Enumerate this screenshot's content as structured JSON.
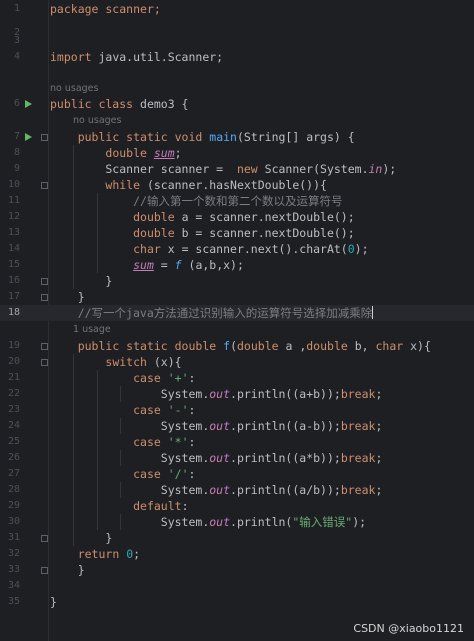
{
  "editor": {
    "hints": {
      "class_usages": "no usages",
      "main_usages": "no usages",
      "f_usages": "1 usage"
    },
    "lines": [
      {
        "n": "1",
        "code": [
          {
            "t": "package scanner;",
            "c": "kw-pkg"
          }
        ]
      },
      {
        "n": "2",
        "code": []
      },
      {
        "n": "3",
        "code": []
      },
      {
        "n": "4",
        "code": [
          {
            "t": "import",
            "c": "kw"
          },
          {
            "t": " java.util.Scanner;"
          }
        ]
      },
      {
        "n": "6",
        "code": [
          {
            "t": "public class",
            "c": "kw"
          },
          {
            "t": " demo3 {"
          }
        ]
      },
      {
        "n": "7",
        "code": [
          {
            "t": "    "
          },
          {
            "t": "public static void",
            "c": "kw"
          },
          {
            "t": " "
          },
          {
            "t": "main",
            "c": "fn"
          },
          {
            "t": "(String[] args) {"
          }
        ]
      },
      {
        "n": "8",
        "code": [
          {
            "t": "        "
          },
          {
            "t": "double",
            "c": "kw"
          },
          {
            "t": " "
          },
          {
            "t": "sum",
            "c": "st ul"
          },
          {
            "t": ";"
          }
        ]
      },
      {
        "n": "9",
        "code": [
          {
            "t": "        Scanner scanner =  "
          },
          {
            "t": "new",
            "c": "kw"
          },
          {
            "t": " Scanner(System."
          },
          {
            "t": "in",
            "c": "st"
          },
          {
            "t": ");"
          }
        ]
      },
      {
        "n": "10",
        "code": [
          {
            "t": "        "
          },
          {
            "t": "while",
            "c": "kw"
          },
          {
            "t": " (scanner.hasNextDouble()){"
          }
        ]
      },
      {
        "n": "11",
        "code": [
          {
            "t": "            "
          },
          {
            "t": "//输入第一个数和第二个数以及运算符号",
            "c": "cm"
          }
        ]
      },
      {
        "n": "12",
        "code": [
          {
            "t": "            "
          },
          {
            "t": "double",
            "c": "kw"
          },
          {
            "t": " a = scanner.nextDouble();"
          }
        ]
      },
      {
        "n": "13",
        "code": [
          {
            "t": "            "
          },
          {
            "t": "double",
            "c": "kw"
          },
          {
            "t": " b = scanner.nextDouble();"
          }
        ]
      },
      {
        "n": "14",
        "code": [
          {
            "t": "            "
          },
          {
            "t": "char",
            "c": "kw"
          },
          {
            "t": " x = scanner.next().charAt("
          },
          {
            "t": "0",
            "c": "num"
          },
          {
            "t": ");"
          }
        ]
      },
      {
        "n": "15",
        "code": [
          {
            "t": "            "
          },
          {
            "t": "sum",
            "c": "st ul"
          },
          {
            "t": " = "
          },
          {
            "t": "f",
            "c": "fn-it"
          },
          {
            "t": " (a,b,x);"
          }
        ]
      },
      {
        "n": "16",
        "code": [
          {
            "t": "        }"
          }
        ]
      },
      {
        "n": "17",
        "code": [
          {
            "t": "    }"
          }
        ]
      },
      {
        "n": "18",
        "code": [
          {
            "t": "    "
          },
          {
            "t": "//写一个java方法通过识别输入的运算符号选择加减乘除",
            "c": "cm"
          }
        ]
      },
      {
        "n": "19",
        "code": [
          {
            "t": "    "
          },
          {
            "t": "public static double",
            "c": "kw"
          },
          {
            "t": " "
          },
          {
            "t": "f",
            "c": "fn"
          },
          {
            "t": "("
          },
          {
            "t": "double",
            "c": "kw"
          },
          {
            "t": " a ,"
          },
          {
            "t": "double",
            "c": "kw"
          },
          {
            "t": " b, "
          },
          {
            "t": "char",
            "c": "kw"
          },
          {
            "t": " x){"
          }
        ]
      },
      {
        "n": "20",
        "code": [
          {
            "t": "        "
          },
          {
            "t": "switch",
            "c": "kw"
          },
          {
            "t": " (x){"
          }
        ]
      },
      {
        "n": "21",
        "code": [
          {
            "t": "            "
          },
          {
            "t": "case",
            "c": "kw"
          },
          {
            "t": " "
          },
          {
            "t": "'+'",
            "c": "str"
          },
          {
            "t": ":"
          }
        ]
      },
      {
        "n": "22",
        "code": [
          {
            "t": "                System."
          },
          {
            "t": "out",
            "c": "st"
          },
          {
            "t": ".println((a+b));"
          },
          {
            "t": "break",
            "c": "kw"
          },
          {
            "t": ";"
          }
        ]
      },
      {
        "n": "23",
        "code": [
          {
            "t": "            "
          },
          {
            "t": "case",
            "c": "kw"
          },
          {
            "t": " "
          },
          {
            "t": "'-'",
            "c": "str"
          },
          {
            "t": ":"
          }
        ]
      },
      {
        "n": "24",
        "code": [
          {
            "t": "                System."
          },
          {
            "t": "out",
            "c": "st"
          },
          {
            "t": ".println((a-b));"
          },
          {
            "t": "break",
            "c": "kw"
          },
          {
            "t": ";"
          }
        ]
      },
      {
        "n": "25",
        "code": [
          {
            "t": "            "
          },
          {
            "t": "case",
            "c": "kw"
          },
          {
            "t": " "
          },
          {
            "t": "'*'",
            "c": "str"
          },
          {
            "t": ":"
          }
        ]
      },
      {
        "n": "26",
        "code": [
          {
            "t": "                System."
          },
          {
            "t": "out",
            "c": "st"
          },
          {
            "t": ".println((a*b));"
          },
          {
            "t": "break",
            "c": "kw"
          },
          {
            "t": ";"
          }
        ]
      },
      {
        "n": "27",
        "code": [
          {
            "t": "            "
          },
          {
            "t": "case",
            "c": "kw"
          },
          {
            "t": " "
          },
          {
            "t": "'/'",
            "c": "str"
          },
          {
            "t": ":"
          }
        ]
      },
      {
        "n": "28",
        "code": [
          {
            "t": "                System."
          },
          {
            "t": "out",
            "c": "st"
          },
          {
            "t": ".println((a/b));"
          },
          {
            "t": "break",
            "c": "kw"
          },
          {
            "t": ";"
          }
        ]
      },
      {
        "n": "29",
        "code": [
          {
            "t": "            "
          },
          {
            "t": "default",
            "c": "kw"
          },
          {
            "t": ":"
          }
        ]
      },
      {
        "n": "30",
        "code": [
          {
            "t": "                System."
          },
          {
            "t": "out",
            "c": "st"
          },
          {
            "t": ".println("
          },
          {
            "t": "\"输入错误\"",
            "c": "str"
          },
          {
            "t": ");"
          }
        ]
      },
      {
        "n": "31",
        "code": [
          {
            "t": "        }"
          }
        ]
      },
      {
        "n": "32",
        "code": [
          {
            "t": "    "
          },
          {
            "t": "return",
            "c": "kw"
          },
          {
            "t": " "
          },
          {
            "t": "0",
            "c": "num"
          },
          {
            "t": ";"
          }
        ]
      },
      {
        "n": "33",
        "code": [
          {
            "t": "    }"
          }
        ]
      },
      {
        "n": "34",
        "code": []
      },
      {
        "n": "35",
        "code": [
          {
            "t": "}"
          }
        ]
      }
    ]
  },
  "watermark": "CSDN @xiaobo1121",
  "colors": {
    "background": "#1e1f22",
    "keyword": "#cf8e6d",
    "function": "#56a8f5",
    "string": "#6aab73",
    "number": "#2aacb8",
    "comment": "#7a7e85",
    "static_field": "#c77dbb",
    "run_icon": "#5fb865"
  }
}
